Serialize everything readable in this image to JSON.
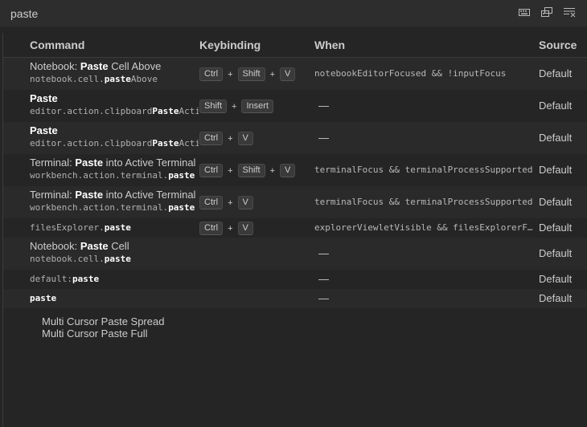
{
  "search": {
    "value": "paste"
  },
  "columns": {
    "command": "Command",
    "keybinding": "Keybinding",
    "when": "When",
    "source": "Source"
  },
  "rows": [
    {
      "title": [
        "Notebook: ",
        "Paste",
        " Cell Above"
      ],
      "id": [
        "notebook.cell.",
        "paste",
        "Above"
      ],
      "keys": [
        "Ctrl",
        "Shift",
        "V"
      ],
      "when": "notebookEditorFocused && !inputFocus",
      "source": "Default"
    },
    {
      "title": [
        "",
        "Paste",
        ""
      ],
      "id": [
        "editor.action.clipboard",
        "Paste",
        "Action"
      ],
      "keys": [
        "Shift",
        "Insert"
      ],
      "when": "—",
      "source": "Default"
    },
    {
      "title": [
        "",
        "Paste",
        ""
      ],
      "id": [
        "editor.action.clipboard",
        "Paste",
        "Action"
      ],
      "keys": [
        "Ctrl",
        "V"
      ],
      "when": "—",
      "source": "Default"
    },
    {
      "title": [
        "Terminal: ",
        "Paste",
        " into Active Terminal"
      ],
      "id": [
        "workbench.action.terminal.",
        "paste",
        ""
      ],
      "keys": [
        "Ctrl",
        "Shift",
        "V"
      ],
      "when": "terminalFocus && terminalProcessSupported",
      "source": "Default"
    },
    {
      "title": [
        "Terminal: ",
        "Paste",
        " into Active Terminal"
      ],
      "id": [
        "workbench.action.terminal.",
        "paste",
        ""
      ],
      "keys": [
        "Ctrl",
        "V"
      ],
      "when": "terminalFocus && terminalProcessSupported",
      "source": "Default"
    },
    {
      "title": null,
      "id": [
        "filesExplorer.",
        "paste",
        ""
      ],
      "keys": [
        "Ctrl",
        "V"
      ],
      "when": "explorerViewletVisible && filesExplorerFocus",
      "source": "Default"
    },
    {
      "title": [
        "Notebook: ",
        "Paste",
        " Cell"
      ],
      "id": [
        "notebook.cell.",
        "paste",
        ""
      ],
      "keys": [],
      "when": "—",
      "source": "Default"
    },
    {
      "title": null,
      "id": [
        "default:",
        "paste",
        ""
      ],
      "keys": [],
      "when": "—",
      "source": "Default"
    },
    {
      "title": null,
      "id": [
        "",
        "paste",
        ""
      ],
      "keys": [],
      "when": "—",
      "source": "Default"
    }
  ],
  "menu": {
    "items": [
      "Multi Cursor Paste Spread",
      "Multi Cursor Paste Full"
    ]
  },
  "icons": {
    "keyboard": "keyboard-icon",
    "record": "record-keys-icon",
    "clear": "clear-filter-icon"
  }
}
